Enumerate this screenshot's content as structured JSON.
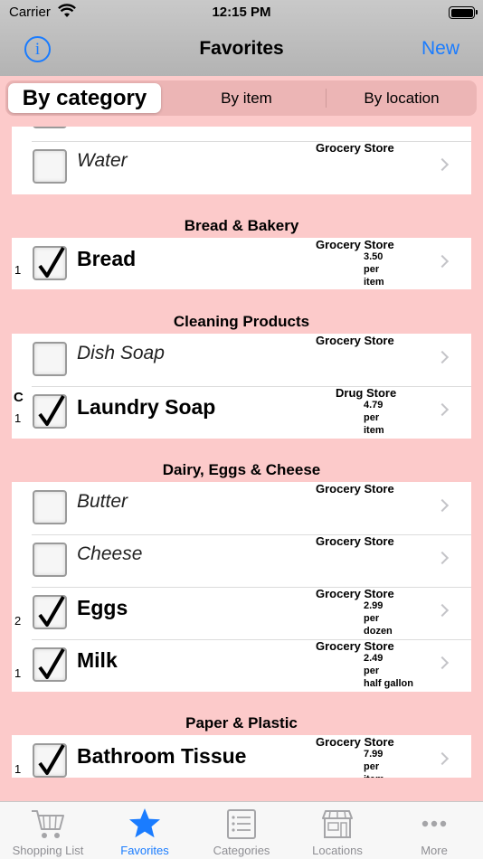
{
  "status_bar": {
    "carrier": "Carrier",
    "time": "12:15 PM"
  },
  "nav": {
    "info_label": "i",
    "title": "Favorites",
    "new_label": "New"
  },
  "segments": [
    "By category",
    "By item",
    "By location"
  ],
  "content": {
    "sections": [
      {
        "header": "",
        "rows": [
          {
            "prefix": "",
            "letter": "",
            "checked": false,
            "name": "Water",
            "store": "Grocery Store",
            "price": []
          }
        ]
      },
      {
        "header": "Bread & Bakery",
        "rows": [
          {
            "prefix": "1",
            "letter": "",
            "checked": true,
            "name": "Bread",
            "store": "Grocery Store",
            "price": [
              "3.50",
              "per",
              "item"
            ]
          }
        ]
      },
      {
        "header": "Cleaning Products",
        "rows": [
          {
            "prefix": "",
            "letter": "",
            "checked": false,
            "name": "Dish Soap",
            "store": "Grocery Store",
            "price": []
          },
          {
            "prefix": "1",
            "letter": "C",
            "checked": true,
            "name": "Laundry Soap",
            "store": "Drug Store",
            "price": [
              "4.79",
              "per",
              "item"
            ]
          }
        ]
      },
      {
        "header": "Dairy, Eggs & Cheese",
        "rows": [
          {
            "prefix": "",
            "letter": "",
            "checked": false,
            "name": "Butter",
            "store": "Grocery Store",
            "price": []
          },
          {
            "prefix": "",
            "letter": "",
            "checked": false,
            "name": "Cheese",
            "store": "Grocery Store",
            "price": []
          },
          {
            "prefix": "2",
            "letter": "",
            "checked": true,
            "name": "Eggs",
            "store": "Grocery Store",
            "price": [
              "2.99",
              "per",
              "dozen"
            ]
          },
          {
            "prefix": "1",
            "letter": "",
            "checked": true,
            "name": "Milk",
            "store": "Grocery Store",
            "price": [
              "2.49",
              "per",
              "half gallon"
            ]
          }
        ]
      },
      {
        "header": "Paper & Plastic",
        "rows": [
          {
            "prefix": "1",
            "letter": "",
            "checked": true,
            "name": "Bathroom Tissue",
            "store": "Grocery Store",
            "price": [
              "7.99",
              "per",
              "item"
            ]
          }
        ]
      }
    ]
  },
  "tabs": [
    {
      "label": "Shopping List",
      "icon": "cart-icon",
      "active": false
    },
    {
      "label": "Favorites",
      "icon": "star-icon",
      "active": true
    },
    {
      "label": "Categories",
      "icon": "list-icon",
      "active": false
    },
    {
      "label": "Locations",
      "icon": "storefront-icon",
      "active": false
    },
    {
      "label": "More",
      "icon": "more-icon",
      "active": false
    }
  ],
  "colors": {
    "accent": "#1a7cff",
    "background": "#fccaca",
    "inactive": "#8e8e93"
  }
}
